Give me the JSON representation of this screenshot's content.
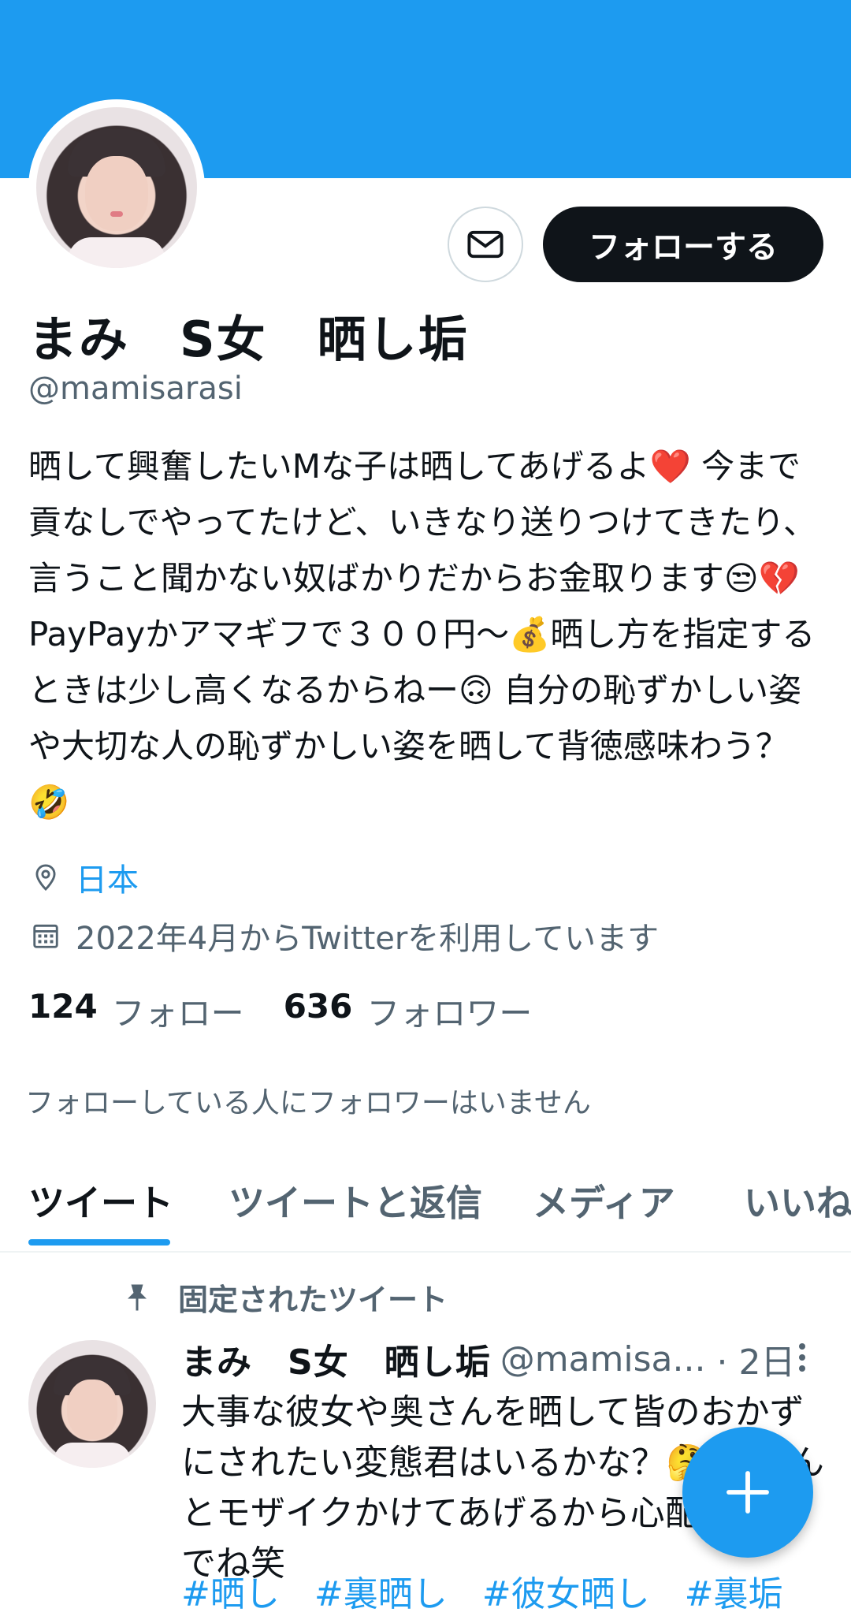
{
  "profile": {
    "display_name": "まみ　S女　晒し垢",
    "handle": "@mamisarasi",
    "bio": "晒して興奮したいMな子は晒してあげるよ❤️ 今まで貢なしでやってたけど、いきなり送りつけてきたり、言うこと聞かない奴ばかりだからお金取ります😒💔 PayPayかアマギフで３００円〜💰晒し方を指定するときは少し高くなるからねー🙃 自分の恥ずかしい姿や大切な人の恥ずかしい姿を晒して背徳感味わう？🤣",
    "location": "日本",
    "joined": "2022年4月からTwitterを利用しています",
    "following_count": "124",
    "following_label": "フォロー",
    "followers_count": "636",
    "followers_label": "フォロワー",
    "no_mutual_followers": "フォローしている人にフォロワーはいません",
    "follow_button_label": "フォローする"
  },
  "tabs": [
    {
      "label": "ツイート",
      "active": true
    },
    {
      "label": "ツイートと返信",
      "active": false
    },
    {
      "label": "メディア",
      "active": false
    },
    {
      "label": "いいね",
      "active": false
    }
  ],
  "pinned_tweet": {
    "pinned_label": "固定されたツイート",
    "author_name": "まみ　S女　晒し垢",
    "author_handle": "@mamisa...",
    "time": "· 2日",
    "text": "大事な彼女や奥さんを晒して皆のおかずにされたい変態君はいるかな？🤔 ちゃんとモザイクかけてあげるから心配しないでね笑",
    "hashtags": "#晒し　#裏晒し　#彼女晒し　#裏垢"
  },
  "colors": {
    "brand": "#1d9bf0",
    "text_primary": "#0f1419",
    "text_secondary": "#536471"
  },
  "icons": {
    "message": "envelope-icon",
    "location": "location-pin-icon",
    "calendar": "calendar-icon",
    "pin": "pin-icon",
    "more": "more-vertical-icon",
    "compose": "plus-icon"
  }
}
